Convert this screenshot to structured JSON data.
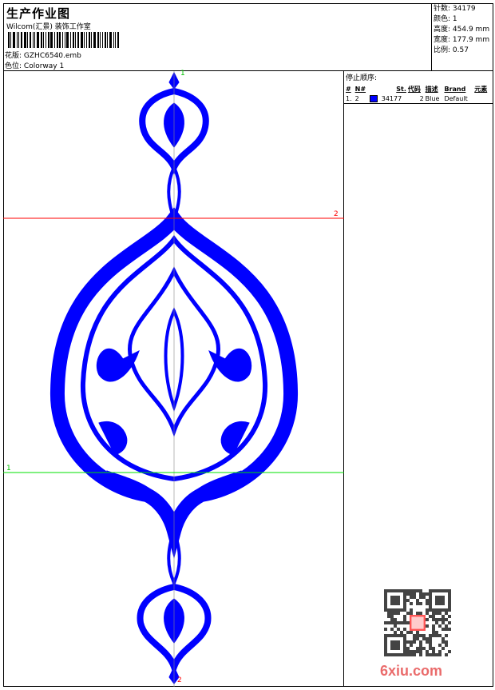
{
  "header": {
    "title": "生产作业图",
    "studio": "Wilcom(汇景) 装饰工作室",
    "design_label": "花版:",
    "design_value": "GZHC6540.emb",
    "colorway_label": "色位:",
    "colorway_value": "Colorway 1"
  },
  "info": {
    "stitches_label": "针数:",
    "stitches": "34179",
    "colors_label": "颜色:",
    "colors": "1",
    "height_label": "高度:",
    "height": "454.9 mm",
    "width_label": "宽度:",
    "width": "177.9 mm",
    "scale_label": "比例:",
    "scale": "0.57"
  },
  "stop_sequence": {
    "title": "停止顺序:",
    "columns": [
      "#",
      "N#",
      "St.",
      "代码",
      "描述",
      "Brand",
      "元素"
    ],
    "rows": [
      {
        "num": "1.",
        "n": "2",
        "color": "#0000ff",
        "stitches": "34177",
        "code": "2",
        "desc": "Blue",
        "brand": "Default"
      }
    ]
  },
  "guides": {
    "red_label": "2",
    "green_label": "1",
    "top_label": "1",
    "bottom_label": "2"
  },
  "watermark": "6xiu.com",
  "colors": {
    "thread": "#0000ff",
    "red_guide": "#ff0000",
    "green_guide": "#00e000"
  }
}
